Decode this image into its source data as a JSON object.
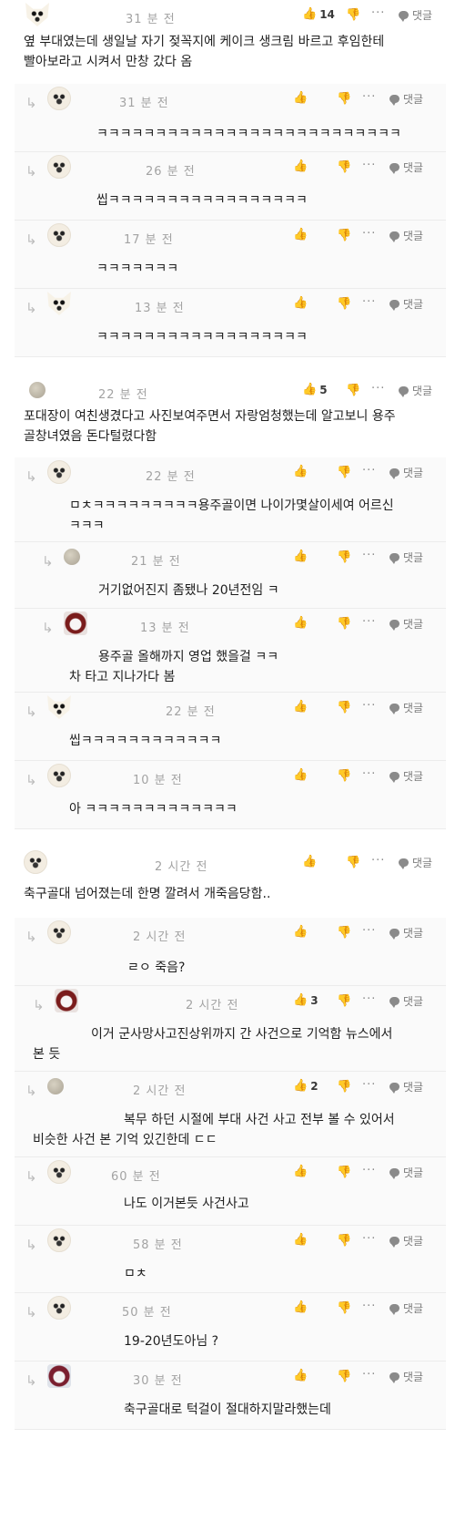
{
  "reply_label": "댓글",
  "more_label": "···",
  "comments": [
    {
      "time": "31 분 전",
      "likes": "14",
      "text": [
        "옆 부대였는데 생일날 자기 젖꼭지에 케이크 생크림 바르고 후임한테",
        "빨아보라고 시켜서 만창 갔다 옴"
      ]
    },
    {
      "time": "31 분 전",
      "likes": "",
      "text": [
        "ㅋㅋㅋㅋㅋㅋㅋㅋㅋㅋㅋㅋㅋㅋㅋㅋㅋㅋㅋㅋㅋㅋㅋㅋㅋㅋ"
      ]
    },
    {
      "time": "26 분 전",
      "likes": "",
      "text": [
        "씹ㅋㅋㅋㅋㅋㅋㅋㅋㅋㅋㅋㅋㅋㅋㅋㅋㅋ"
      ]
    },
    {
      "time": "17 분 전",
      "likes": "",
      "text": [
        "ㅋㅋㅋㅋㅋㅋㅋ"
      ]
    },
    {
      "time": "13 분 전",
      "likes": "",
      "text": [
        "ㅋㅋㅋㅋㅋㅋㅋㅋㅋㅋㅋㅋㅋㅋㅋㅋㅋㅋ"
      ]
    },
    {
      "time": "22 분 전",
      "likes": "5",
      "text": [
        "포대장이 여친생겼다고 사진보여주면서 자랑엄청했는데 알고보니 용주",
        "골창녀였음 돈다털렸다함"
      ]
    },
    {
      "time": "22 분 전",
      "likes": "",
      "text": [
        "ㅁㅊㅋㅋㅋㅋㅋㅋㅋㅋㅋ용주골이면 나이가몇살이세여 어르신",
        "ㅋㅋㅋ"
      ]
    },
    {
      "time": "21 분 전",
      "likes": "",
      "text": [
        "거기없어진지 좀됐나 20년전임 ㅋ"
      ]
    },
    {
      "time": "13 분 전",
      "likes": "",
      "text": [
        "용주골 올해까지 영업 했을걸 ㅋㅋ",
        "차 타고 지나가다 봄"
      ]
    },
    {
      "time": "22 분 전",
      "likes": "",
      "text": [
        "씹ㅋㅋㅋㅋㅋㅋㅋㅋㅋㅋㅋㅋ"
      ]
    },
    {
      "time": "10 분 전",
      "likes": "",
      "text": [
        "아 ㅋㅋㅋㅋㅋㅋㅋㅋㅋㅋㅋㅋㅋ"
      ]
    },
    {
      "time": "2 시간 전",
      "likes": "",
      "text": [
        "축구골대 넘어졌는데 한명 깔려서 개죽음당함.."
      ]
    },
    {
      "time": "2 시간 전",
      "likes": "",
      "text": [
        "ㄹㅇ 죽음?"
      ]
    },
    {
      "time": "2 시간 전",
      "likes": "3",
      "text": [
        "이거 군사망사고진상위까지 간 사건으로 기억함 뉴스에서",
        "본 듯"
      ]
    },
    {
      "time": "2 시간 전",
      "likes": "2",
      "text": [
        "복무 하던 시절에 부대 사건 사고 전부 볼 수 있어서",
        "비슷한 사건 본 기억 있긴한데 ㄷㄷ"
      ]
    },
    {
      "time": "60 분 전",
      "likes": "",
      "text": [
        "나도 이거본듯 사건사고"
      ]
    },
    {
      "time": "58 분 전",
      "likes": "",
      "text": [
        "ㅁㅊ"
      ]
    },
    {
      "time": "50 분 전",
      "likes": "",
      "text": [
        "19-20년도아님 ?"
      ]
    },
    {
      "time": "30 분 전",
      "likes": "",
      "text": [
        "축구골대로 턱걸이 절대하지말라했는데"
      ]
    }
  ]
}
